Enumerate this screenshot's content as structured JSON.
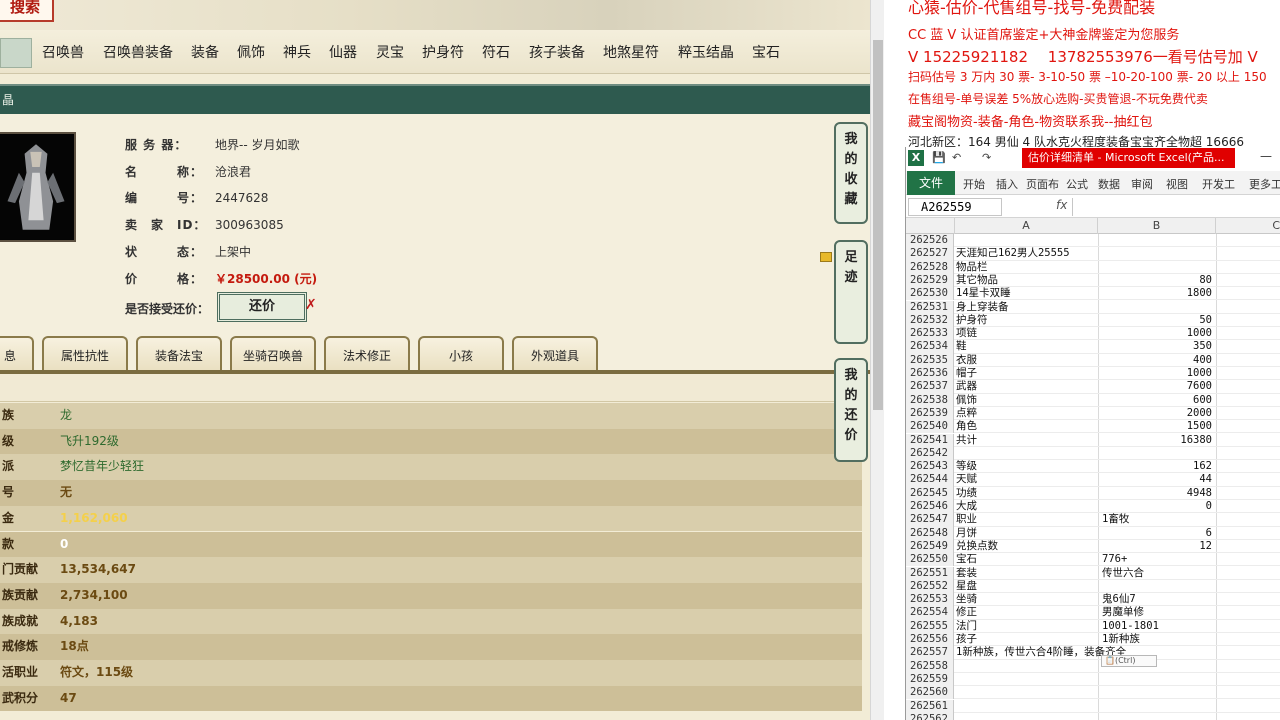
{
  "game_page": {
    "logo_text": "搜索",
    "categories": [
      "召唤兽",
      "召唤兽装备",
      "装备",
      "佩饰",
      "神兵",
      "仙器",
      "灵宝",
      "护身符",
      "符石",
      "孩子装备",
      "地煞星符",
      "粹玉结晶",
      "宝石"
    ],
    "section_title": "晶",
    "info": {
      "server_label": "服 务 器：",
      "server_value": "地界-- 岁月如歌",
      "name_label": "名　　　称：",
      "name_value": "沧浪君",
      "id_label": "编　　　号：",
      "id_value": "2447628",
      "seller_label": "卖　家　ID：",
      "seller_value": "300963085",
      "status_label": "状　　　态：",
      "status_value": "上架中",
      "price_label": "价　　　格：",
      "price_value": "￥28500.00 (元)",
      "counter_label": "是否接受还价：",
      "counter_button": "还价",
      "counter_x": "✗"
    },
    "tabs": [
      "息",
      "属性抗性",
      "装备法宝",
      "坐骑召唤兽",
      "法术修正",
      "小孩",
      "外观道具"
    ],
    "side_buttons": [
      [
        "我",
        "的",
        "收",
        "藏"
      ],
      [
        "足",
        "迹"
      ],
      [
        "我",
        "的",
        "还",
        "价"
      ]
    ],
    "stats": [
      {
        "k": "族",
        "v": "龙",
        "style": "green"
      },
      {
        "k": "级",
        "v": "飞升192级",
        "style": "green"
      },
      {
        "k": "派",
        "v": "梦忆昔年少轻狂",
        "style": "green"
      },
      {
        "k": "号",
        "v": "无",
        "style": "brown"
      },
      {
        "k": "金",
        "v": "1,162,060",
        "style": "gold"
      },
      {
        "k": "款",
        "v": "0",
        "style": "white"
      },
      {
        "k": "门贡献",
        "v": "13,534,647",
        "style": "brown"
      },
      {
        "k": "族贡献",
        "v": "2,734,100",
        "style": "brown"
      },
      {
        "k": "族成就",
        "v": "4,183",
        "style": "brown"
      },
      {
        "k": "戒修炼",
        "v": "18点",
        "style": "brown"
      },
      {
        "k": "活职业",
        "v": "符文，115级",
        "style": "brown"
      },
      {
        "k": "武积分",
        "v": "47",
        "style": "brown"
      }
    ]
  },
  "overlay": {
    "title": "心猿-估价-代售组号-找号-免费配装",
    "line1": "CC 蓝 V 认证首席鉴定+大神金牌鉴定为您服务",
    "line2": "V 15225921182　 13782553976一看号估号加 V",
    "line3": "扫码估号 3 万内 30 票- 3-10-50 票 –10-20-100 票- 20 以上 150",
    "line4": "在售组号-单号误差 5%放心选购-买贵管退-不玩免费代卖",
    "line5": "藏宝阁物资-装备-角色-物资联系我--抽红包",
    "line6": "河北新区：164 男仙 4 队水克火程度装备宝宝齐全物超 16666"
  },
  "excel": {
    "logo": "X",
    "title": "估价详细清单 - Microsoft Excel(产品...",
    "quick_access": [
      "💾",
      "↶",
      "↷"
    ],
    "file_tab": "文件",
    "ribbon_tabs": [
      "开始",
      "插入",
      "页面布",
      "公式",
      "数据",
      "审阅",
      "视图",
      "开发工",
      "更多工"
    ],
    "name_box": "A262559",
    "fx": "fx",
    "columns": [
      "A",
      "B",
      "C"
    ],
    "paste_hint": "📋(Ctrl)",
    "rows": [
      {
        "n": "262526",
        "a": "",
        "b": "",
        "t": ""
      },
      {
        "n": "262527",
        "a": "天涯知己162男人25555",
        "b": "",
        "t": ""
      },
      {
        "n": "262528",
        "a": "物品栏",
        "b": "",
        "t": ""
      },
      {
        "n": "262529",
        "a": "其它物品",
        "b": "80",
        "t": "num"
      },
      {
        "n": "262530",
        "a": "14星卡双睡",
        "b": "1800",
        "t": "num"
      },
      {
        "n": "262531",
        "a": "身上穿装备",
        "b": "",
        "t": ""
      },
      {
        "n": "262532",
        "a": "护身符",
        "b": "50",
        "t": "num"
      },
      {
        "n": "262533",
        "a": "项链",
        "b": "1000",
        "t": "num"
      },
      {
        "n": "262534",
        "a": "鞋",
        "b": "350",
        "t": "num"
      },
      {
        "n": "262535",
        "a": "衣服",
        "b": "400",
        "t": "num"
      },
      {
        "n": "262536",
        "a": "帽子",
        "b": "1000",
        "t": "num"
      },
      {
        "n": "262537",
        "a": "武器",
        "b": "7600",
        "t": "num"
      },
      {
        "n": "262538",
        "a": "佩饰",
        "b": "600",
        "t": "num"
      },
      {
        "n": "262539",
        "a": "点粹",
        "b": "2000",
        "t": "num"
      },
      {
        "n": "262540",
        "a": "角色",
        "b": "1500",
        "t": "num"
      },
      {
        "n": "262541",
        "a": "共计",
        "b": "16380",
        "t": "num"
      },
      {
        "n": "262542",
        "a": "",
        "b": "",
        "t": ""
      },
      {
        "n": "262543",
        "a": "等级",
        "b": "162",
        "t": "num"
      },
      {
        "n": "262544",
        "a": "天赋",
        "b": "44",
        "t": "num"
      },
      {
        "n": "262545",
        "a": "功绩",
        "b": "4948",
        "t": "num"
      },
      {
        "n": "262546",
        "a": "大成",
        "b": "0",
        "t": "num"
      },
      {
        "n": "262547",
        "a": "职业",
        "b": "1畜牧",
        "t": "txt"
      },
      {
        "n": "262548",
        "a": "月饼",
        "b": "6",
        "t": "num"
      },
      {
        "n": "262549",
        "a": "兑换点数",
        "b": "12",
        "t": "num"
      },
      {
        "n": "262550",
        "a": "宝石",
        "b": "776+",
        "t": "txt"
      },
      {
        "n": "262551",
        "a": "套装",
        "b": "传世六合",
        "t": "txt"
      },
      {
        "n": "262552",
        "a": "星盘",
        "b": "",
        "t": ""
      },
      {
        "n": "262553",
        "a": "坐骑",
        "b": "鬼6仙7",
        "t": "txt"
      },
      {
        "n": "262554",
        "a": "修正",
        "b": "男魔单修",
        "t": "txt"
      },
      {
        "n": "262555",
        "a": "法门",
        "b": "1001-1801",
        "t": "txt"
      },
      {
        "n": "262556",
        "a": "孩子",
        "b": "1新种族",
        "t": "txt"
      },
      {
        "n": "262557",
        "a": "1新种族，传世六合4阶睡，装备齐全",
        "b": "",
        "t": ""
      },
      {
        "n": "262558",
        "a": "",
        "b": "",
        "t": ""
      },
      {
        "n": "262559",
        "a": "",
        "b": "",
        "t": ""
      },
      {
        "n": "262560",
        "a": "",
        "b": "",
        "t": ""
      },
      {
        "n": "262561",
        "a": "",
        "b": "",
        "t": ""
      },
      {
        "n": "262562",
        "a": "",
        "b": "",
        "t": ""
      }
    ]
  }
}
